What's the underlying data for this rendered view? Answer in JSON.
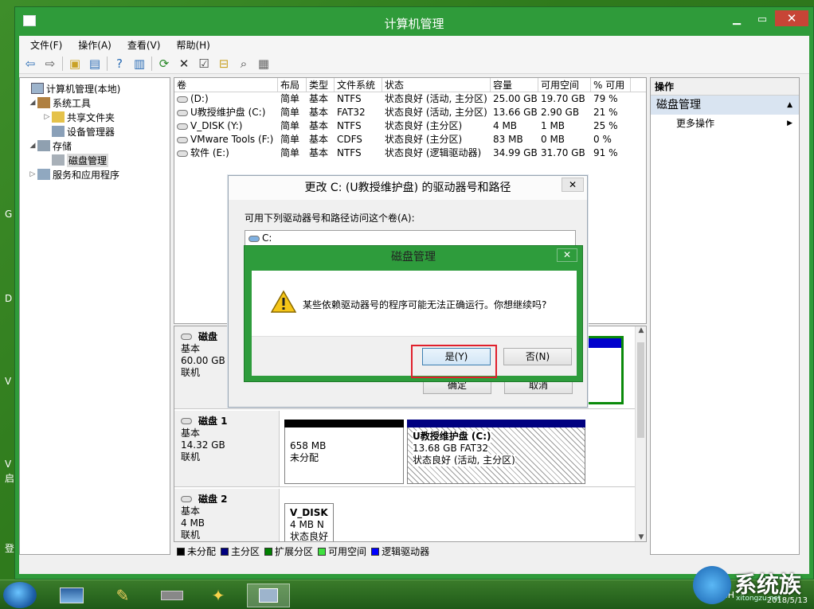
{
  "window": {
    "title": "计算机管理"
  },
  "menu": [
    "文件(F)",
    "操作(A)",
    "查看(V)",
    "帮助(H)"
  ],
  "tree": [
    {
      "label": "计算机管理(本地)",
      "level": 0,
      "twisty": ""
    },
    {
      "label": "系统工具",
      "level": 1,
      "twisty": "◢"
    },
    {
      "label": "共享文件夹",
      "level": 2,
      "twisty": "▷"
    },
    {
      "label": "设备管理器",
      "level": 2,
      "twisty": ""
    },
    {
      "label": "存储",
      "level": 1,
      "twisty": "◢"
    },
    {
      "label": "磁盘管理",
      "level": 2,
      "twisty": ""
    },
    {
      "label": "服务和应用程序",
      "level": 1,
      "twisty": "▷"
    }
  ],
  "volumes": {
    "headers": [
      "卷",
      "布局",
      "类型",
      "文件系统",
      "状态",
      "容量",
      "可用空间",
      "% 可用"
    ],
    "rows": [
      [
        "(D:)",
        "简单",
        "基本",
        "NTFS",
        "状态良好 (活动, 主分区)",
        "25.00 GB",
        "19.70 GB",
        "79 %"
      ],
      [
        "U教授维护盘 (C:)",
        "简单",
        "基本",
        "FAT32",
        "状态良好 (活动, 主分区)",
        "13.66 GB",
        "2.90 GB",
        "21 %"
      ],
      [
        "V_DISK (Y:)",
        "简单",
        "基本",
        "NTFS",
        "状态良好 (主分区)",
        "4 MB",
        "1 MB",
        "25 %"
      ],
      [
        "VMware Tools (F:)",
        "简单",
        "基本",
        "CDFS",
        "状态良好 (主分区)",
        "83 MB",
        "0 MB",
        "0 %"
      ],
      [
        "软件 (E:)",
        "简单",
        "基本",
        "NTFS",
        "状态良好 (逻辑驱动器)",
        "34.99 GB",
        "31.70 GB",
        "91 %"
      ]
    ]
  },
  "disks": [
    {
      "name": "磁盘",
      "type": "基本",
      "size": "60.00 GB",
      "status": "联机"
    },
    {
      "name": "磁盘 1",
      "type": "基本",
      "size": "14.32 GB",
      "status": "联机",
      "parts": [
        {
          "l1": "",
          "l2": "658 MB",
          "l3": "未分配"
        },
        {
          "l1": "U教授维护盘  (C:)",
          "l2": "13.68 GB FAT32",
          "l3": "状态良好 (活动, 主分区)"
        }
      ]
    },
    {
      "name": "磁盘 2",
      "type": "基本",
      "size": "4 MB",
      "status": "联机",
      "parts": [
        {
          "l1": "V_DISK",
          "l2": "4 MB N",
          "l3": "状态良好"
        }
      ]
    }
  ],
  "legend": [
    {
      "label": "未分配",
      "color": "#000000"
    },
    {
      "label": "主分区",
      "color": "#000080"
    },
    {
      "label": "扩展分区",
      "color": "#008000"
    },
    {
      "label": "可用空间",
      "color": "#40e040"
    },
    {
      "label": "逻辑驱动器",
      "color": "#0000ff"
    }
  ],
  "actions": {
    "header": "操作",
    "section": "磁盘管理",
    "item": "更多操作"
  },
  "dialog1": {
    "title": "更改 C: (U教授维护盘) 的驱动器号和路径",
    "label": "可用下列驱动器号和路径访问这个卷(A):",
    "item": "C:",
    "ok": "确定",
    "cancel": "取消"
  },
  "dialog2": {
    "title": "磁盘管理",
    "message": "某些依赖驱动器号的程序可能无法正确运行。你想继续吗?",
    "yes": "是(Y)",
    "no": "否(N)"
  },
  "taskbar": {
    "tray": "CH",
    "date": "2018/5/13",
    "logo_text": "系统族",
    "logo_sub": "xitongzu.net"
  },
  "desktop_chars": [
    "G",
    "D",
    "V",
    "V",
    "启",
    "登"
  ]
}
